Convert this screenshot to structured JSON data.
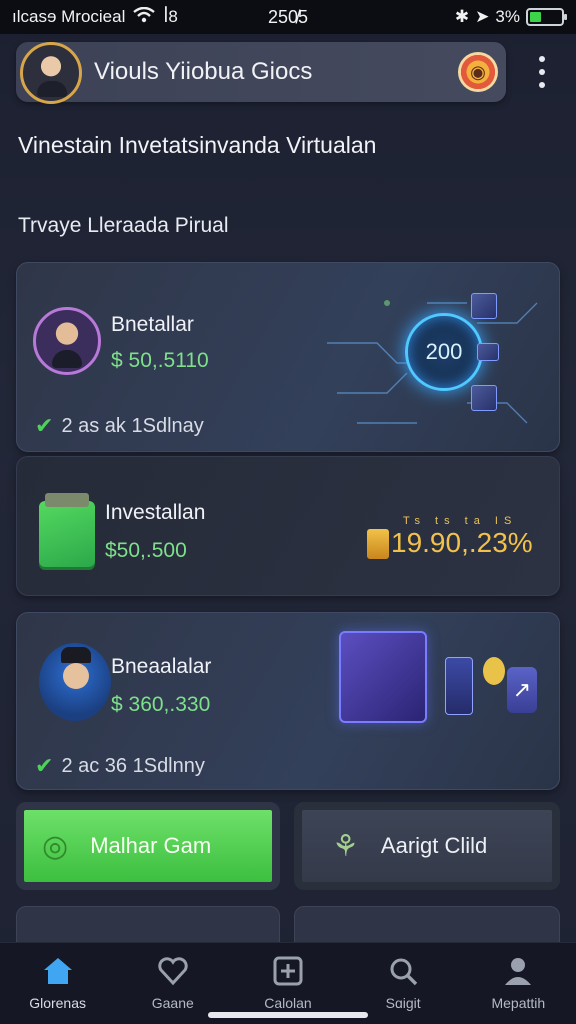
{
  "status_bar": {
    "carrier": "ılcasɘ Mrocieal",
    "alt_text": "ꟾ8",
    "time": "250̸5",
    "battery": "3%",
    "battery_level": 0.35
  },
  "header": {
    "title": "Viouls Yiiobua Giocs"
  },
  "heading": "Vinestain Invetatsinvanda Virtualan",
  "subheading": "Trvaye Lleraada Pirual",
  "cards": [
    {
      "name": "Bnetallar",
      "amount": "$ 50,.5110",
      "footer": "2 as ak 1Sdlnay",
      "hologram_value": "200"
    },
    {
      "name": "Investallan",
      "amount": "$50,.500",
      "mini_numbers": "Ts ts ta IS",
      "percent": "19.90,.23%"
    },
    {
      "name": "Bneaalalar",
      "amount": "$ 360,.330",
      "footer": "2 ac 36 1Sdlnny"
    }
  ],
  "buttons": {
    "primary_label": "Malhar Gam",
    "secondary_label": "Aarigt Clild"
  },
  "tabs": [
    {
      "label": "Glorenas",
      "icon": "home-icon",
      "active": true
    },
    {
      "label": "Gaane",
      "icon": "heart-icon",
      "active": false
    },
    {
      "label": "Calolan",
      "icon": "plus-square-icon",
      "active": false
    },
    {
      "label": "Sɑigit",
      "icon": "search-icon",
      "active": false
    },
    {
      "label": "Mepattih",
      "icon": "profile-icon",
      "active": false
    }
  ],
  "colors": {
    "accent": "#41a6f2",
    "positive": "#7ee08a",
    "gold": "#f1c14c",
    "primary_button": "#4fcf4e"
  }
}
